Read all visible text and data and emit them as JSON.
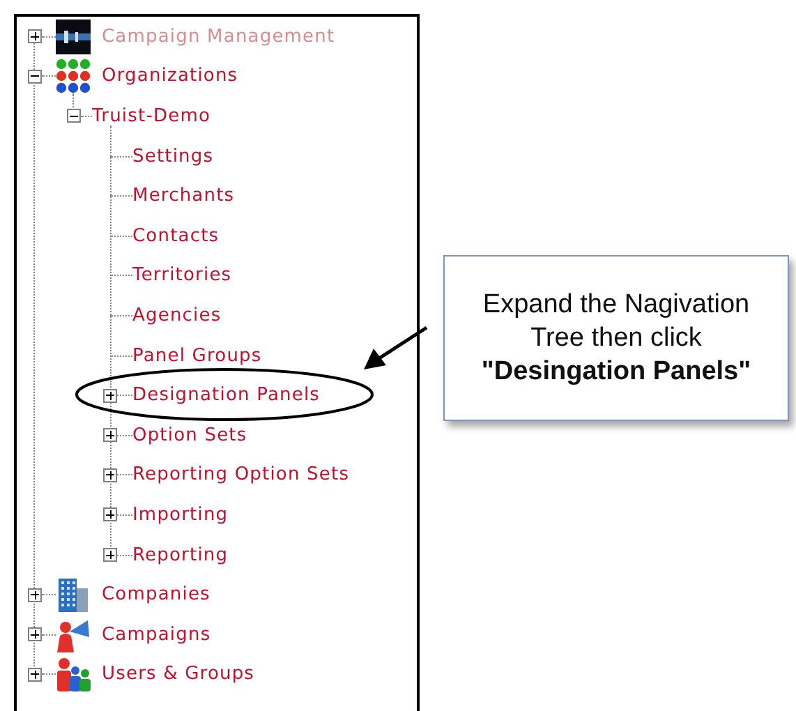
{
  "tree": [
    {
      "label": "Campaign Management",
      "expanded": false,
      "disabled": true
    },
    {
      "label": "Organizations",
      "expanded": true,
      "disabled": false,
      "children": [
        {
          "label": "Truist-Demo",
          "expanded": true,
          "children": [
            {
              "label": "Settings"
            },
            {
              "label": "Merchants"
            },
            {
              "label": "Contacts"
            },
            {
              "label": "Territories"
            },
            {
              "label": "Agencies"
            },
            {
              "label": "Panel Groups"
            },
            {
              "label": "Designation Panels",
              "expanded": false
            },
            {
              "label": "Option Sets",
              "expanded": false
            },
            {
              "label": "Reporting Option Sets",
              "expanded": false
            },
            {
              "label": "Importing",
              "expanded": false
            },
            {
              "label": "Reporting",
              "expanded": false
            }
          ]
        }
      ]
    },
    {
      "label": "Companies",
      "expanded": false,
      "disabled": false
    },
    {
      "label": "Campaigns",
      "expanded": false,
      "disabled": false
    },
    {
      "label": "Users & Groups",
      "expanded": false,
      "disabled": false
    }
  ],
  "callout": {
    "text": "Expand the Nagivation Tree then click **\"Desingation Panels\"**"
  }
}
